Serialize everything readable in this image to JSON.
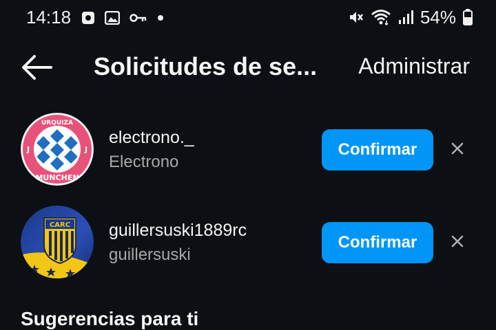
{
  "status_bar": {
    "time": "14:18",
    "left_icons": [
      "screenshot-icon",
      "gallery-icon",
      "key-icon",
      "dot-icon"
    ],
    "right_icons": [
      "mute-icon",
      "wifi-icon",
      "signal-icon",
      "battery-icon"
    ],
    "battery": "54%"
  },
  "header": {
    "title": "Solicitudes de se...",
    "manage_label": "Administrar"
  },
  "requests": [
    {
      "username": "electrono._",
      "name": "Electrono",
      "confirm_label": "Confirmar",
      "avatar": "urquiza-munchen-crest"
    },
    {
      "username": "guillersuski1889rc",
      "name": "guillersuski",
      "confirm_label": "Confirmar",
      "avatar": "carc-crest-flag"
    }
  ],
  "avatar_text": {
    "a1_top": "URQUIZA",
    "a1_bottom": "MUNCHEN",
    "a1_left": "J",
    "a1_right": "J",
    "a2_top": "CARC"
  },
  "suggestions_heading": "Sugerencias para ti",
  "colors": {
    "background": "#0c1014",
    "button": "#0095f6",
    "secondary_text": "#a8a8a8"
  }
}
